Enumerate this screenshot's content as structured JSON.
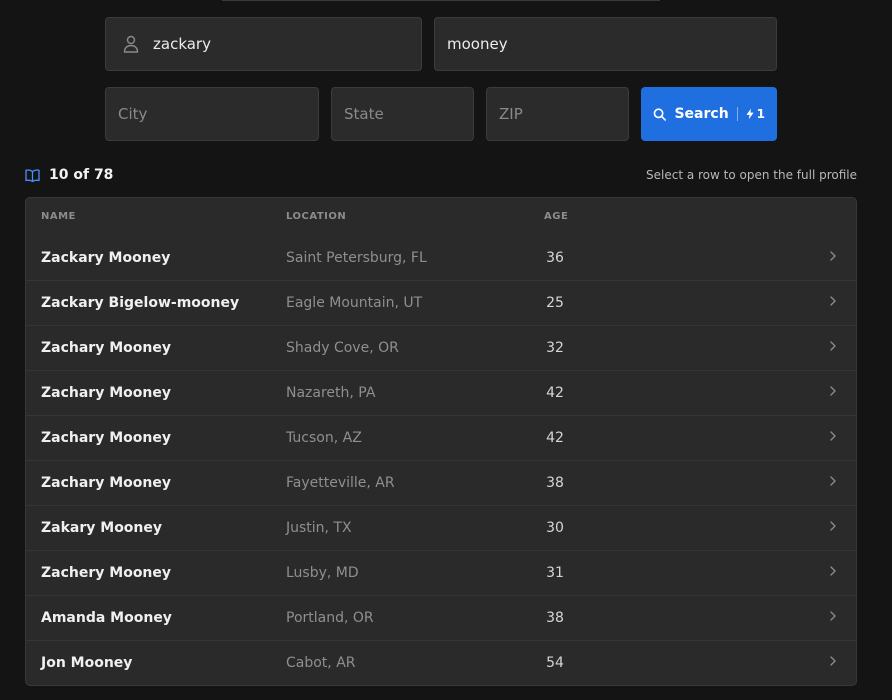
{
  "search": {
    "first_name": {
      "value": "zackary",
      "placeholder": ""
    },
    "last_name": {
      "value": "mooney",
      "placeholder": ""
    },
    "city": {
      "value": "",
      "placeholder": "City"
    },
    "state": {
      "value": "",
      "placeholder": "State"
    },
    "zip": {
      "value": "",
      "placeholder": "ZIP"
    },
    "button_label": "Search",
    "credit_cost": "1"
  },
  "results": {
    "count_label": "10 of 78",
    "hint": "Select a row to open the full profile"
  },
  "table": {
    "headers": {
      "name": "NAME",
      "location": "LOCATION",
      "age": "AGE"
    },
    "rows": [
      {
        "name": "Zackary Mooney",
        "location": "Saint Petersburg, FL",
        "age": "36"
      },
      {
        "name": "Zackary Bigelow-mooney",
        "location": "Eagle Mountain, UT",
        "age": "25"
      },
      {
        "name": "Zachary Mooney",
        "location": "Shady Cove, OR",
        "age": "32"
      },
      {
        "name": "Zachary Mooney",
        "location": "Nazareth, PA",
        "age": "42"
      },
      {
        "name": "Zachary Mooney",
        "location": "Tucson, AZ",
        "age": "42"
      },
      {
        "name": "Zachary Mooney",
        "location": "Fayetteville, AR",
        "age": "38"
      },
      {
        "name": "Zakary Mooney",
        "location": "Justin, TX",
        "age": "30"
      },
      {
        "name": "Zachery Mooney",
        "location": "Lusby, MD",
        "age": "31"
      },
      {
        "name": "Amanda Mooney",
        "location": "Portland, OR",
        "age": "38"
      },
      {
        "name": "Jon Mooney",
        "location": "Cabot, AR",
        "age": "54"
      }
    ]
  },
  "colors": {
    "background": "#141414",
    "accent": "#1f6fe0",
    "field_bg": "#2b2b2b",
    "table_bg": "#2a2a2a"
  },
  "icons": {
    "first_name_field": "person-icon",
    "search_button": "search-icon",
    "credit": "lightning-icon",
    "results": "book-icon",
    "row_action": "chevron-right-icon"
  }
}
